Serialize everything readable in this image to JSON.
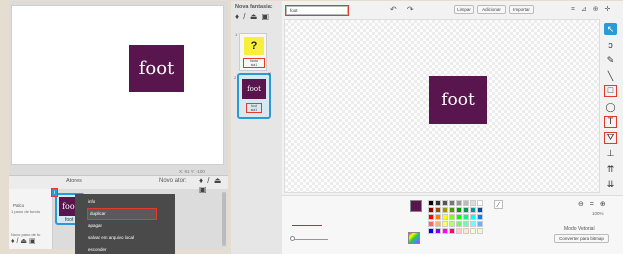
{
  "stage": {
    "sprite_text": "foot",
    "coords": "X: 91  Y: -100"
  },
  "sprites": {
    "header_label": "Atores",
    "new_sprite_label": "Novo ator:",
    "new_sprite_icons": "♦ / ⏏ ▣",
    "stage_thumb_title": "Palco",
    "stage_thumb_sub": "1 pano de fundo",
    "stage_thumb_new_bg": "Novo pano de fu",
    "stage_thumb_icons": "♦ / ⏏ ▣",
    "card": {
      "thumb_text": "foot",
      "name": "foot",
      "info_glyph": "i"
    },
    "context_menu": [
      "info",
      "duplicar",
      "apagar",
      "salvar em arquivo local",
      "esconder"
    ],
    "highlighted_item": "duplicar"
  },
  "costumes": {
    "new_costume_label": "Nova fantasia:",
    "new_costume_icons": "♦ / ⏏ ▣",
    "items": [
      {
        "number": "1",
        "thumb_text": "?",
        "label_line1": "fanta",
        "label_line2": "sia1"
      },
      {
        "number": "2",
        "thumb_text": "foot",
        "label_line1": "foot",
        "label_line2": "sia1"
      }
    ],
    "close_glyph": "×"
  },
  "editor": {
    "costume_name": "foot",
    "undo_redo": "↶ ↷",
    "buttons": {
      "clear": "Limpar",
      "add": "Adicionar",
      "import": "Importar"
    },
    "zoom_icons": "⌗ ⊿ ⊕ ✛",
    "canvas_text": "foot",
    "tools": [
      {
        "name": "select",
        "glyph": "↖",
        "selected": true,
        "highlighted": false
      },
      {
        "name": "reshape",
        "glyph": "ↄ",
        "selected": false,
        "highlighted": false
      },
      {
        "name": "pencil",
        "glyph": "✎",
        "selected": false,
        "highlighted": false
      },
      {
        "name": "line",
        "glyph": "╲",
        "selected": false,
        "highlighted": false
      },
      {
        "name": "rectangle",
        "glyph": "□",
        "selected": false,
        "highlighted": true
      },
      {
        "name": "ellipse",
        "glyph": "◯",
        "selected": false,
        "highlighted": false
      },
      {
        "name": "text",
        "glyph": "T",
        "selected": false,
        "highlighted": true
      },
      {
        "name": "fill",
        "glyph": "⛛",
        "selected": false,
        "highlighted": true
      },
      {
        "name": "stamp",
        "glyph": "⊥",
        "selected": false,
        "highlighted": false
      },
      {
        "name": "forward",
        "glyph": "⇈",
        "selected": false,
        "highlighted": false
      },
      {
        "name": "back",
        "glyph": "⇊",
        "selected": false,
        "highlighted": false
      }
    ],
    "zoom_controls": "⊖ = ⊕",
    "zoom_percent": "100%",
    "mode_label": "Modo Vetorial",
    "convert_button": "Converter para bitmap"
  },
  "colors": {
    "accent": "#2a9ad6",
    "highlight": "#e33a2c",
    "sprite_fill": "#59164e",
    "palette": [
      "#000000",
      "#333333",
      "#555555",
      "#777777",
      "#999999",
      "#bbbbbb",
      "#dddddd",
      "#ffffff",
      "#990000",
      "#994c00",
      "#999900",
      "#4c9900",
      "#009900",
      "#00994c",
      "#009999",
      "#004c99",
      "#ff0000",
      "#ff8000",
      "#ffff00",
      "#80ff00",
      "#00ff00",
      "#00ff80",
      "#00ffff",
      "#0080ff",
      "#ff6666",
      "#ffb266",
      "#ffff66",
      "#b2ff66",
      "#66ff66",
      "#66ffb2",
      "#66ffff",
      "#66b2ff",
      "#0000ff",
      "#7f00ff",
      "#ff00ff",
      "#ff007f",
      "#ffcccc",
      "#ffe5cc",
      "#ffffcc",
      "#e5ffcc"
    ]
  }
}
